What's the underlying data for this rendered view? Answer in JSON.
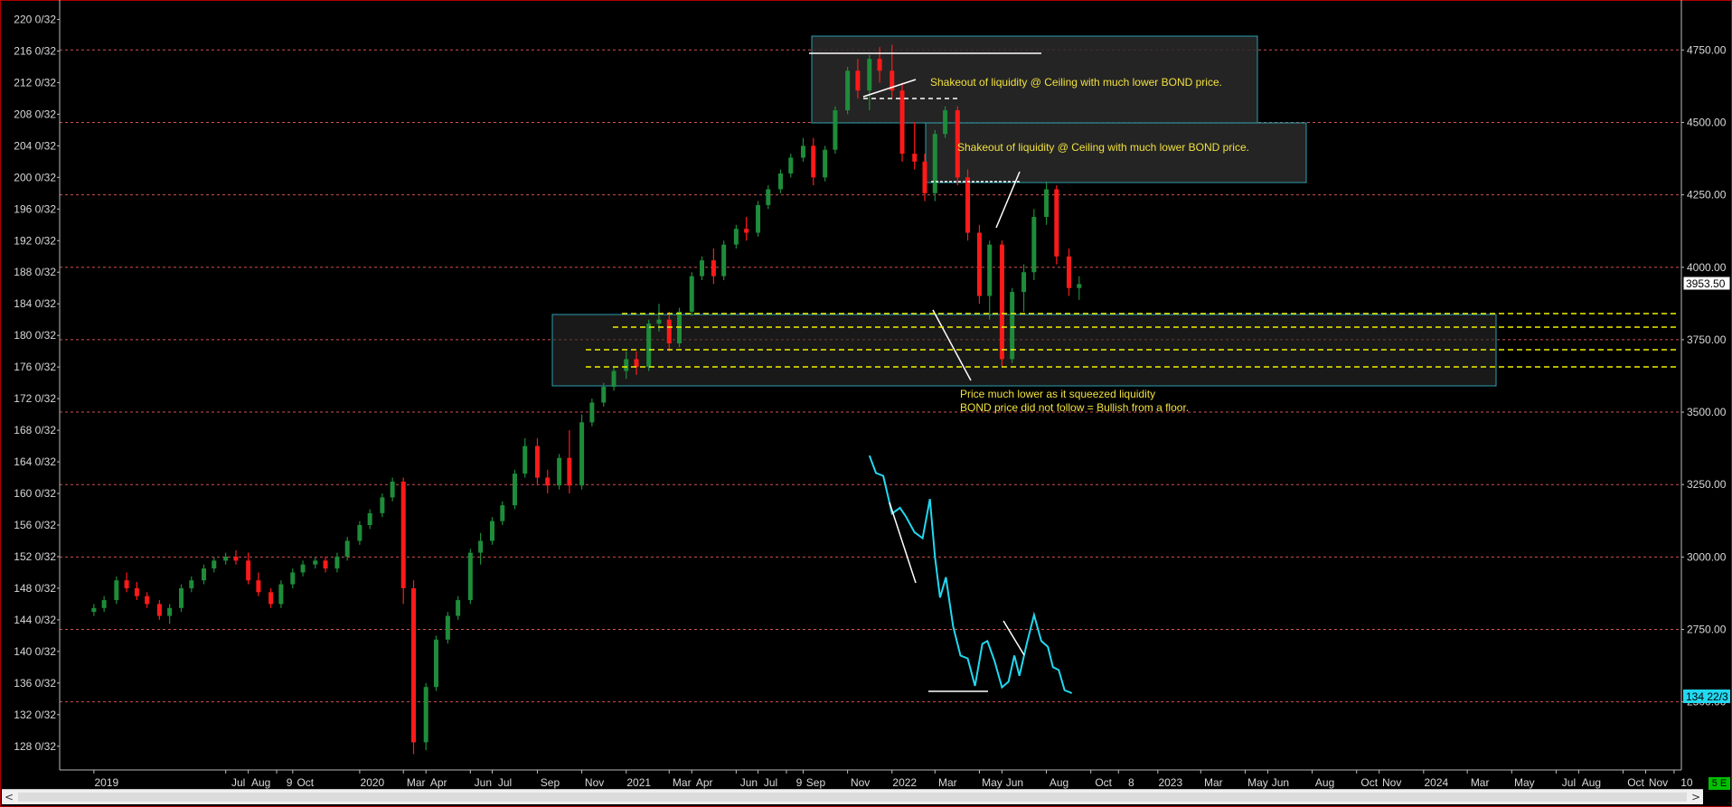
{
  "colors": {
    "background": "#000000",
    "bull_candle": "#1e8c3a",
    "bear_candle": "#ff1a1a",
    "grid": "#d05050",
    "bond_line": "#22d8f0",
    "zone_line": "#f0f000",
    "annotation_text": "#f0e040",
    "badge": "#00c000"
  },
  "chart_data": {
    "type": "candlestick",
    "x_labels": [
      "2019",
      "Jul",
      "Aug",
      "9",
      "Oct",
      "2020",
      "Mar",
      "Apr",
      "Jun",
      "Jul",
      "Sep",
      "Nov",
      "2021",
      "Mar",
      "Apr",
      "Jun",
      "Jul",
      "9",
      "Sep",
      "Nov",
      "2022",
      "Mar",
      "May",
      "Jun",
      "Aug",
      "Oct",
      "8",
      "2023",
      "Mar",
      "May",
      "Jun",
      "Aug",
      "Oct",
      "Nov",
      "2024",
      "Mar",
      "May",
      "Jul",
      "Aug",
      "Oct",
      "Nov",
      "10"
    ],
    "x_dates": [
      "2019-01-01",
      "2019-07-01",
      "2019-08-01",
      "2019-09-09",
      "2019-10-01",
      "2020-01-01",
      "2020-03-01",
      "2020-04-01",
      "2020-06-01",
      "2020-07-01",
      "2020-09-01",
      "2020-11-01",
      "2021-01-01",
      "2021-03-01",
      "2021-04-01",
      "2021-06-01",
      "2021-07-01",
      "2021-08-09",
      "2021-09-01",
      "2021-11-01",
      "2022-01-01",
      "2022-03-01",
      "2022-05-01",
      "2022-06-01",
      "2022-08-01",
      "2022-10-01",
      "2022-11-08",
      "2023-01-01",
      "2023-03-01",
      "2023-05-01",
      "2023-06-01",
      "2023-08-01",
      "2023-10-01",
      "2023-11-01",
      "2024-01-01",
      "2024-03-01",
      "2024-05-01",
      "2024-07-01",
      "2024-08-01",
      "2024-10-01",
      "2024-11-01",
      "2024-12-10"
    ],
    "x_range": [
      "2018-11-15",
      "2024-12-20"
    ],
    "left_axis": {
      "labels": [
        "220 0/32",
        "216 0/32",
        "212 0/32",
        "208 0/32",
        "204 0/32",
        "200 0/32",
        "196 0/32",
        "192 0/32",
        "188 0/32",
        "184 0/32",
        "180 0/32",
        "176 0/32",
        "172 0/32",
        "168 0/32",
        "164 0/32",
        "160 0/32",
        "156 0/32",
        "152 0/32",
        "148 0/32",
        "144 0/32",
        "140 0/32",
        "136 0/32",
        "132 0/32",
        "128 0/32"
      ],
      "values": [
        220,
        216,
        212,
        208,
        204,
        200,
        196,
        192,
        188,
        184,
        180,
        176,
        172,
        168,
        164,
        160,
        156,
        152,
        148,
        144,
        140,
        136,
        132,
        128
      ],
      "range": [
        125,
        222
      ]
    },
    "right_axis": {
      "labels": [
        "4750.00",
        "4500.00",
        "4250.00",
        "4000.00",
        "3750.00",
        "3500.00",
        "3250.00",
        "3000.00",
        "2750.00",
        "2500.00"
      ],
      "values": [
        4750,
        4500,
        4250,
        4000,
        3750,
        3500,
        3250,
        3000,
        2750,
        2500
      ],
      "range": [
        2265,
        4910
      ],
      "last_price": "3953.50",
      "bond_last": "134 22/3"
    },
    "grid": "horizontal dashed",
    "series": [
      {
        "kind": "candles",
        "axis": "left",
        "points": [
          [
            "2019-01-01",
            145,
            146,
            144.5,
            145.5
          ],
          [
            "2019-01-15",
            145.5,
            147,
            145,
            146.5
          ],
          [
            "2019-02-01",
            146.5,
            149.5,
            146,
            149
          ],
          [
            "2019-02-15",
            149,
            150,
            147.5,
            148
          ],
          [
            "2019-03-01",
            148,
            148.8,
            146.5,
            147
          ],
          [
            "2019-03-15",
            147,
            147.5,
            145.5,
            146
          ],
          [
            "2019-04-01",
            146,
            146.5,
            144,
            144.5
          ],
          [
            "2019-04-15",
            144.5,
            146,
            143.5,
            145.5
          ],
          [
            "2019-05-01",
            145.5,
            148.5,
            145,
            148
          ],
          [
            "2019-05-15",
            148,
            149.5,
            147.5,
            149
          ],
          [
            "2019-06-01",
            149,
            151,
            148.5,
            150.5
          ],
          [
            "2019-06-15",
            150.5,
            152,
            150,
            151.5
          ],
          [
            "2019-07-01",
            151.5,
            152.5,
            151,
            152
          ],
          [
            "2019-07-15",
            152,
            152.8,
            151,
            151.5
          ],
          [
            "2019-08-01",
            151.5,
            152.5,
            148.5,
            149
          ],
          [
            "2019-08-15",
            149,
            150,
            147,
            147.5
          ],
          [
            "2019-09-01",
            147.5,
            148,
            145.5,
            146
          ],
          [
            "2019-09-15",
            146,
            149,
            145.5,
            148.5
          ],
          [
            "2019-10-01",
            148.5,
            150.5,
            148,
            150
          ],
          [
            "2019-10-15",
            150,
            151.5,
            149.5,
            151
          ],
          [
            "2019-11-01",
            151,
            152,
            150.5,
            151.5
          ],
          [
            "2019-11-15",
            151.5,
            152,
            150,
            150.5
          ],
          [
            "2019-12-01",
            150.5,
            152.5,
            150,
            152
          ],
          [
            "2019-12-15",
            152,
            154.5,
            151.5,
            154
          ],
          [
            "2020-01-01",
            154,
            156.5,
            153.5,
            156
          ],
          [
            "2020-01-15",
            156,
            158,
            155.5,
            157.5
          ],
          [
            "2020-02-01",
            157.5,
            160,
            157,
            159.5
          ],
          [
            "2020-02-15",
            159.5,
            162,
            159,
            161.5
          ],
          [
            "2020-03-01",
            161.5,
            162,
            146,
            148
          ],
          [
            "2020-03-15",
            148,
            149,
            127,
            128.5
          ],
          [
            "2020-04-01",
            128.5,
            136,
            127.5,
            135.5
          ],
          [
            "2020-04-15",
            135.5,
            142,
            135,
            141.5
          ],
          [
            "2020-05-01",
            141.5,
            145,
            141,
            144.5
          ],
          [
            "2020-05-15",
            144.5,
            147,
            144,
            146.5
          ],
          [
            "2020-06-01",
            146.5,
            153,
            146,
            152.5
          ],
          [
            "2020-06-15",
            152.5,
            155,
            151,
            154
          ],
          [
            "2020-07-01",
            154,
            157,
            153.5,
            156.5
          ],
          [
            "2020-07-15",
            156.5,
            159,
            156,
            158.5
          ],
          [
            "2020-08-01",
            158.5,
            163,
            158,
            162.5
          ],
          [
            "2020-08-15",
            162.5,
            167,
            162,
            166
          ],
          [
            "2020-09-01",
            166,
            167,
            161,
            162
          ],
          [
            "2020-09-15",
            162,
            163,
            160,
            161
          ],
          [
            "2020-10-01",
            161,
            165,
            160.5,
            164.5
          ],
          [
            "2020-10-15",
            164.5,
            168,
            160,
            161
          ],
          [
            "2020-11-01",
            161,
            170,
            160.5,
            169
          ],
          [
            "2020-11-15",
            169,
            172,
            168.5,
            171.5
          ],
          [
            "2020-12-01",
            171.5,
            174,
            171,
            173.5
          ],
          [
            "2020-12-15",
            173.5,
            176,
            173,
            175.5
          ],
          [
            "2021-01-01",
            175.5,
            178,
            174.5,
            177
          ],
          [
            "2021-01-15",
            177,
            178,
            175,
            176
          ],
          [
            "2021-02-01",
            176,
            182,
            175.5,
            181.5
          ],
          [
            "2021-02-15",
            181.5,
            184,
            180.5,
            182
          ],
          [
            "2021-03-01",
            182,
            183,
            178,
            179
          ],
          [
            "2021-03-15",
            179,
            183.5,
            178.5,
            183
          ],
          [
            "2021-04-01",
            183,
            188,
            182.5,
            187.5
          ],
          [
            "2021-04-15",
            187.5,
            190,
            187,
            189.5
          ],
          [
            "2021-05-01",
            189.5,
            191,
            186.5,
            187.5
          ],
          [
            "2021-05-15",
            187.5,
            192,
            187,
            191.5
          ],
          [
            "2021-06-01",
            191.5,
            194,
            191,
            193.5
          ],
          [
            "2021-06-15",
            193.5,
            195,
            192,
            193
          ],
          [
            "2021-07-01",
            193,
            197,
            192.5,
            196.5
          ],
          [
            "2021-07-15",
            196.5,
            199,
            196,
            198.5
          ],
          [
            "2021-08-01",
            198.5,
            201,
            198,
            200.5
          ],
          [
            "2021-08-15",
            200.5,
            203,
            200,
            202.5
          ],
          [
            "2021-09-01",
            202.5,
            205,
            202,
            204
          ],
          [
            "2021-09-15",
            204,
            205,
            199,
            200
          ],
          [
            "2021-10-01",
            200,
            204,
            199.5,
            203.5
          ],
          [
            "2021-10-15",
            203.5,
            209,
            203,
            208.5
          ],
          [
            "2021-11-01",
            208.5,
            214,
            208,
            213.5
          ],
          [
            "2021-11-15",
            213.5,
            215,
            210,
            211
          ],
          [
            "2021-12-01",
            211,
            215.5,
            208.5,
            215
          ],
          [
            "2021-12-15",
            215,
            216.5,
            212,
            213.5
          ],
          [
            "2022-01-01",
            213.5,
            216.8,
            210,
            211
          ],
          [
            "2022-01-15",
            211,
            212,
            202,
            203
          ],
          [
            "2022-02-01",
            203,
            207,
            201,
            202
          ],
          [
            "2022-02-15",
            202,
            203,
            197,
            198
          ],
          [
            "2022-03-01",
            198,
            206,
            197,
            205.5
          ],
          [
            "2022-03-15",
            205.5,
            209,
            205,
            208.5
          ],
          [
            "2022-04-01",
            208.5,
            209,
            199,
            200
          ],
          [
            "2022-04-15",
            200,
            201,
            192,
            193
          ],
          [
            "2022-05-01",
            193,
            194,
            184,
            185
          ],
          [
            "2022-05-15",
            185,
            192,
            182,
            191.5
          ],
          [
            "2022-06-01",
            191.5,
            192,
            176,
            177
          ],
          [
            "2022-06-15",
            177,
            186,
            176.5,
            185.5
          ],
          [
            "2022-07-01",
            185.5,
            189,
            183,
            188
          ],
          [
            "2022-07-15",
            188,
            196,
            187,
            195
          ],
          [
            "2022-08-01",
            195,
            199.5,
            194,
            198.5
          ],
          [
            "2022-08-15",
            198.5,
            199,
            189,
            190
          ],
          [
            "2022-09-01",
            190,
            191,
            185,
            186
          ],
          [
            "2022-09-15",
            186,
            187.5,
            184.5,
            186.5
          ]
        ]
      },
      {
        "kind": "line",
        "axis": "right",
        "name": "",
        "points": [
          [
            "2021-12-01",
            3350
          ],
          [
            "2021-12-10",
            3290
          ],
          [
            "2021-12-20",
            3280
          ],
          [
            "2022-01-01",
            3150
          ],
          [
            "2022-01-12",
            3170
          ],
          [
            "2022-01-20",
            3140
          ],
          [
            "2022-02-01",
            3085
          ],
          [
            "2022-02-12",
            3065
          ],
          [
            "2022-02-22",
            3200
          ],
          [
            "2022-03-01",
            3000
          ],
          [
            "2022-03-08",
            2860
          ],
          [
            "2022-03-16",
            2930
          ],
          [
            "2022-03-26",
            2760
          ],
          [
            "2022-04-05",
            2660
          ],
          [
            "2022-04-15",
            2650
          ],
          [
            "2022-04-25",
            2555
          ],
          [
            "2022-05-05",
            2700
          ],
          [
            "2022-05-12",
            2710
          ],
          [
            "2022-05-22",
            2640
          ],
          [
            "2022-06-01",
            2550
          ],
          [
            "2022-06-10",
            2570
          ],
          [
            "2022-06-18",
            2660
          ],
          [
            "2022-06-25",
            2590
          ],
          [
            "2022-07-05",
            2700
          ],
          [
            "2022-07-15",
            2800
          ],
          [
            "2022-07-25",
            2710
          ],
          [
            "2022-08-03",
            2690
          ],
          [
            "2022-08-10",
            2620
          ],
          [
            "2022-08-18",
            2610
          ],
          [
            "2022-08-26",
            2540
          ],
          [
            "2022-09-05",
            2530
          ]
        ]
      }
    ],
    "annotations": [
      {
        "text": "Shakeout of liquidity @ Ceiling with much lower BOND price."
      },
      {
        "text": "Shakeout of liquidity @ Ceiling with much lower BOND price."
      },
      {
        "text": "Price much lower as it squeezed liquidity"
      },
      {
        "text": "BOND price did not follow = Bullish from a floor."
      }
    ]
  },
  "status": {
    "period": "5 E"
  },
  "scrollbar": {
    "left_arrow": "<",
    "right_arrow": ">"
  }
}
